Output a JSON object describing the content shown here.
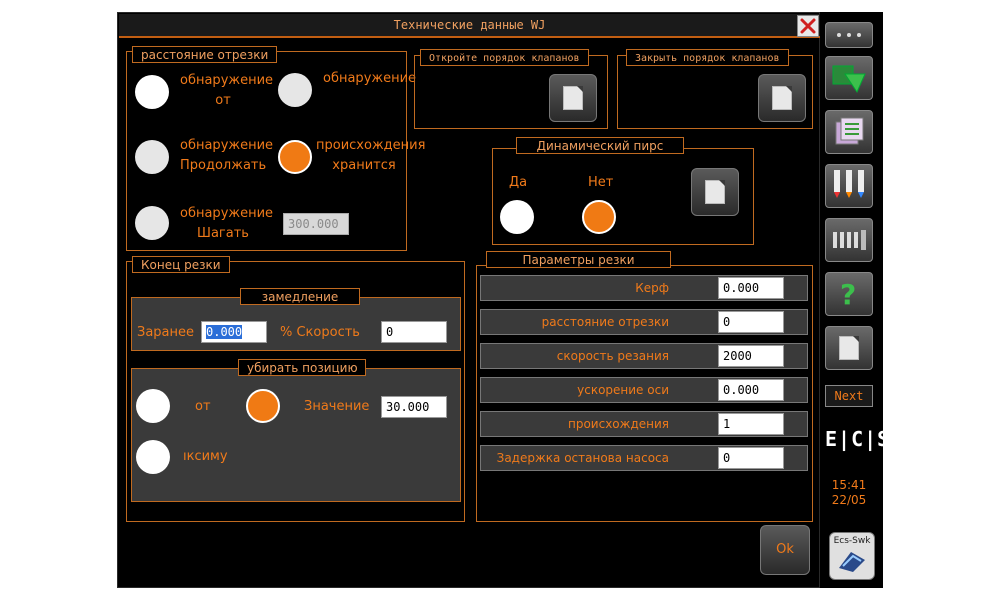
{
  "window": {
    "title": "Технические данные WJ"
  },
  "cut_distance": {
    "legend": "расстояние отрезки",
    "options": [
      {
        "line1": "обнаружение",
        "line2": "от"
      },
      {
        "line1": "обнаружение",
        "line2": ""
      },
      {
        "line1": "обнаружение",
        "line2": "Продолжать"
      },
      {
        "line1": "происхождения",
        "line2": "хранится"
      },
      {
        "line1": "обнаружение",
        "line2": "Шагать"
      }
    ],
    "step_value": "300.000"
  },
  "open_valve_order": {
    "legend": "Откройте порядок клапанов"
  },
  "close_valve_order": {
    "legend": "Закрыть порядок клапанов"
  },
  "dynamic_pierce": {
    "legend": "Динамический пирс",
    "yes": "Да",
    "no": "Нет",
    "selected": "Нет"
  },
  "cut_end": {
    "legend": "Конец резки",
    "slowdown": {
      "legend": "замедление",
      "advance_label": "Заранее",
      "advance_value": "0.000",
      "speed_label": "% Скорость",
      "speed_value": "0"
    },
    "retract": {
      "legend": "убирать позицию",
      "option_from": "от",
      "value_label": "Значение",
      "value": "30.000",
      "option_max": "ıксиму",
      "selected": "value"
    }
  },
  "cut_params": {
    "legend": "Параметры резки",
    "rows": [
      {
        "label": "Керф",
        "value": "0.000"
      },
      {
        "label": "расстояние отрезки",
        "value": "0"
      },
      {
        "label": "скорость резания",
        "value": "2000"
      },
      {
        "label": "ускорение оси",
        "value": "0.000"
      },
      {
        "label": "происхождения",
        "value": "1"
      },
      {
        "label": "Задержка останова насоса",
        "value": "0"
      }
    ]
  },
  "ok_label": "Ok",
  "sidebar": {
    "next_label": "Next",
    "logo": "E|C|S",
    "time": "15:41",
    "date": "22/05",
    "badge": "Ecs-Swk"
  },
  "colors": {
    "accent": "#f07a1a",
    "border": "#c06a20",
    "panel": "#3a3a3a"
  }
}
